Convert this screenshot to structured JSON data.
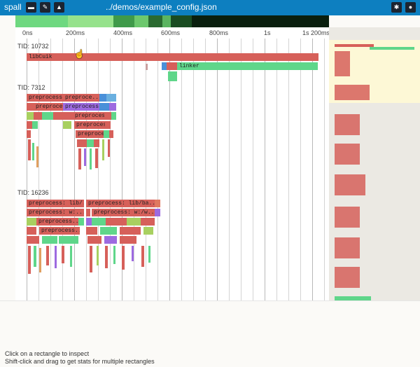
{
  "app": {
    "name": "spall",
    "file_path": "../demos/example_config.json",
    "toolbar_left": [
      {
        "icon": "folder-open-icon",
        "glyph": "▬"
      },
      {
        "icon": "pin-icon",
        "glyph": "✎"
      },
      {
        "icon": "mountain-chart-icon",
        "glyph": "▲"
      }
    ],
    "toolbar_right": [
      {
        "icon": "bug-icon",
        "glyph": "✱"
      },
      {
        "icon": "circle-icon",
        "glyph": "●"
      }
    ]
  },
  "timeline": {
    "ticks": [
      "0ns",
      "200ms",
      "400ms",
      "600ms",
      "800ms",
      "1s",
      "1s 200ms"
    ],
    "threads": [
      {
        "tid": "TID: 10732",
        "labeled_bars": [
          "libCuik",
          "linker"
        ]
      },
      {
        "tid": "TID: 7312",
        "labeled_bars": [
          "preprocess...",
          "preproce...",
          "preprocess...",
          "preprocess...",
          "preprocess...",
          "preprocess...",
          "preprocess...",
          "preproce..."
        ]
      },
      {
        "tid": "TID: 16236",
        "labeled_bars": [
          "preprocess: lib/...",
          "preprocess: lib/ba...",
          "preprocess: w:...",
          "preprocess: w:/w...",
          "preprocess...",
          "preprocess..."
        ]
      }
    ]
  },
  "colors": {
    "titlebar": "#0d7fc0",
    "bar_red": "#d6605a",
    "bar_green": "#5fd68a",
    "bar_purple": "#9d6ae0",
    "bar_blue": "#4a90d9",
    "highlight_yellow": "#fdf8d6"
  },
  "status": {
    "hint_1": "Click on a rectangle to inspect",
    "hint_2": "Shift-click and drag to get stats for multiple rectangles"
  }
}
